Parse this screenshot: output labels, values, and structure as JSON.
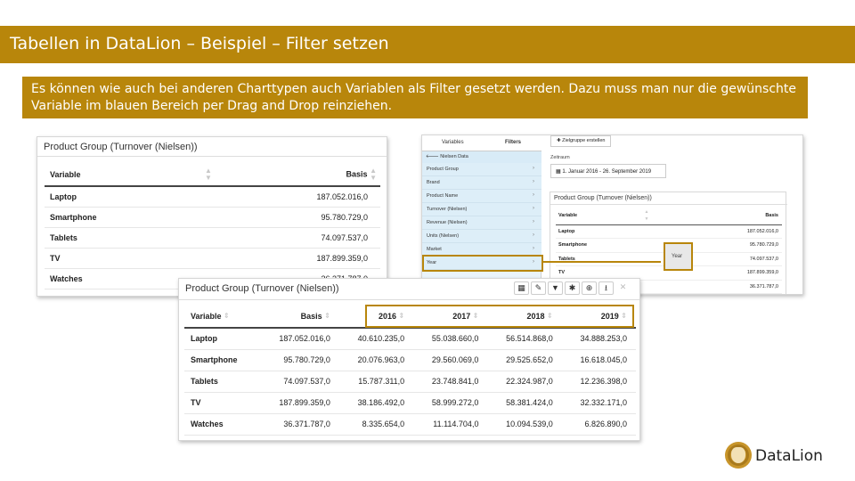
{
  "slide": {
    "title": "Tabellen in DataLion – Beispiel –  Filter setzen",
    "description": "Es können wie auch bei anderen Charttypen auch Variablen als Filter gesetzt werden. Dazu muss man nur die gewünschte Variable im blauen Bereich per Drag and Drop reinziehen.",
    "brand_name": "DataLion",
    "accent_color": "#b8860b"
  },
  "left_table": {
    "title": "Product Group (Turnover (Nielsen))",
    "columns": [
      "Variable",
      "Basis"
    ],
    "rows": [
      [
        "Laptop",
        "187.052.016,0"
      ],
      [
        "Smartphone",
        "95.780.729,0"
      ],
      [
        "Tablets",
        "74.097.537,0"
      ],
      [
        "TV",
        "187.899.359,0"
      ],
      [
        "Watches",
        "36.371.787,0"
      ]
    ]
  },
  "builder": {
    "tabs": [
      "Variables",
      "Filters"
    ],
    "back_label": "Nielsen Data",
    "variables": [
      "Product Group",
      "Brand",
      "Product Name",
      "Turnover (Nielsen)",
      "Revenue (Nielsen)",
      "Units (Nielsen)",
      "Market",
      "Year"
    ],
    "target_button": "Zielgruppe erstellen",
    "zeitraum_label": "Zeitraum",
    "date_range": "1. Januar 2016 - 26. September 2019",
    "drag_label": "Year",
    "inner_table": {
      "title": "Product Group (Turnover (Nielsen))",
      "columns": [
        "Variable",
        "Basis"
      ],
      "rows": [
        [
          "Laptop",
          "187.052.016,0"
        ],
        [
          "Smartphone",
          "95.780.729,0"
        ],
        [
          "Tablets",
          "74.097.537,0"
        ],
        [
          "TV",
          "187.899.359,0"
        ],
        [
          "",
          "36.371.787,0"
        ]
      ]
    }
  },
  "big_table": {
    "title": "Product Group (Turnover (Nielsen))",
    "tools": [
      "table-icon",
      "pencil-icon",
      "filter-icon",
      "gear-icon",
      "zoom-icon",
      "download-icon",
      "close-icon"
    ],
    "tool_glyphs": [
      "▦",
      "✎",
      "▼",
      "✱",
      "⊕",
      "⭳",
      "✕"
    ],
    "columns": [
      "Variable",
      "Basis",
      "2016",
      "2017",
      "2018",
      "2019"
    ],
    "rows": [
      [
        "Laptop",
        "187.052.016,0",
        "40.610.235,0",
        "55.038.660,0",
        "56.514.868,0",
        "34.888.253,0"
      ],
      [
        "Smartphone",
        "95.780.729,0",
        "20.076.963,0",
        "29.560.069,0",
        "29.525.652,0",
        "16.618.045,0"
      ],
      [
        "Tablets",
        "74.097.537,0",
        "15.787.311,0",
        "23.748.841,0",
        "22.324.987,0",
        "12.236.398,0"
      ],
      [
        "TV",
        "187.899.359,0",
        "38.186.492,0",
        "58.999.272,0",
        "58.381.424,0",
        "32.332.171,0"
      ],
      [
        "Watches",
        "36.371.787,0",
        "8.335.654,0",
        "11.114.704,0",
        "10.094.539,0",
        "6.826.890,0"
      ]
    ]
  }
}
